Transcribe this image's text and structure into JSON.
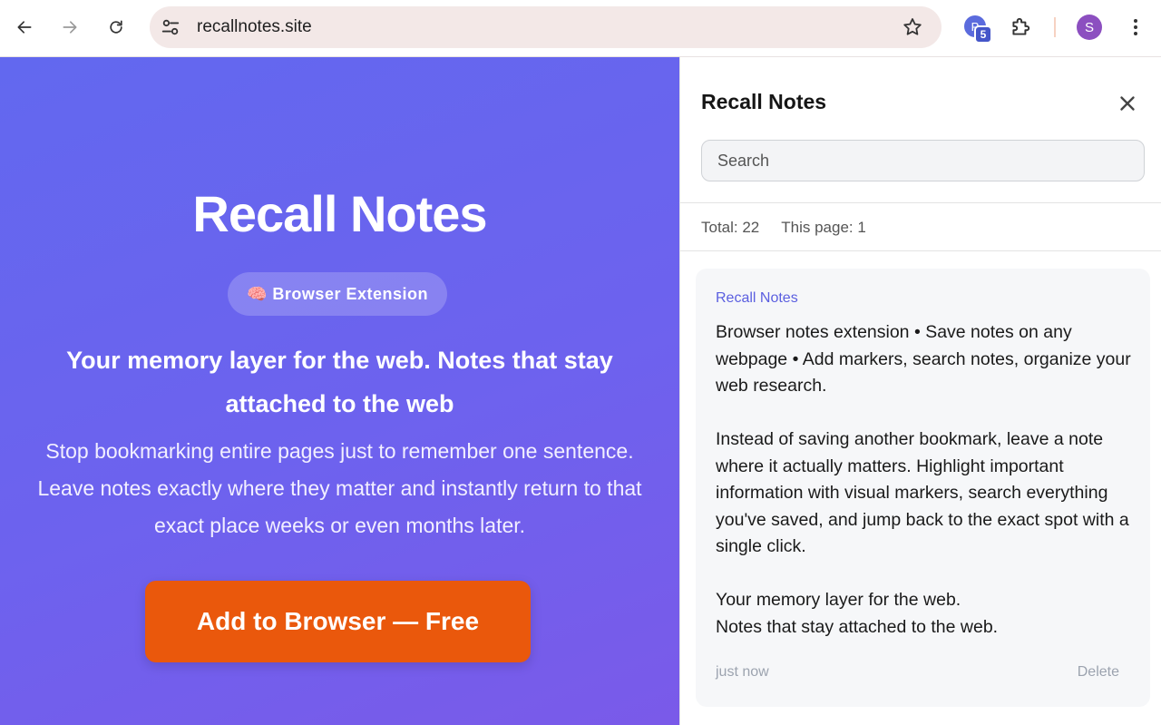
{
  "browser": {
    "url": "recallnotes.site",
    "extension_letter": "P",
    "extension_count": "5",
    "profile_initial": "S"
  },
  "hero": {
    "title": "Recall Notes",
    "badge": "🧠 Browser Extension",
    "subtitle": "Your memory layer for the web. Notes that stay attached to the web",
    "description": "Stop bookmarking entire pages just to remember one sentence. Leave notes exactly where they matter and instantly return to that exact place weeks or even months later.",
    "cta": "Add to Browser — Free"
  },
  "panel": {
    "title": "Recall Notes",
    "search_placeholder": "Search",
    "total": "Total: 22",
    "this_page": "This page: 1",
    "note": {
      "source": "Recall Notes",
      "body": "Browser notes extension • Save notes on any webpage • Add markers, search notes, organize your web research.\n\nInstead of saving another bookmark, leave a note where it actually matters. Highlight important information with visual markers, search everything you've saved, and jump back to the exact spot with a single click.\n\nYour memory layer for the web.\nNotes that stay attached to the web.",
      "time": "just now",
      "delete_label": "Delete"
    }
  },
  "colors": {
    "hero_gradient_start": "#6268ef",
    "hero_gradient_end": "#7a5ae9",
    "cta": "#ea580c",
    "accent": "#5b5fe0"
  }
}
